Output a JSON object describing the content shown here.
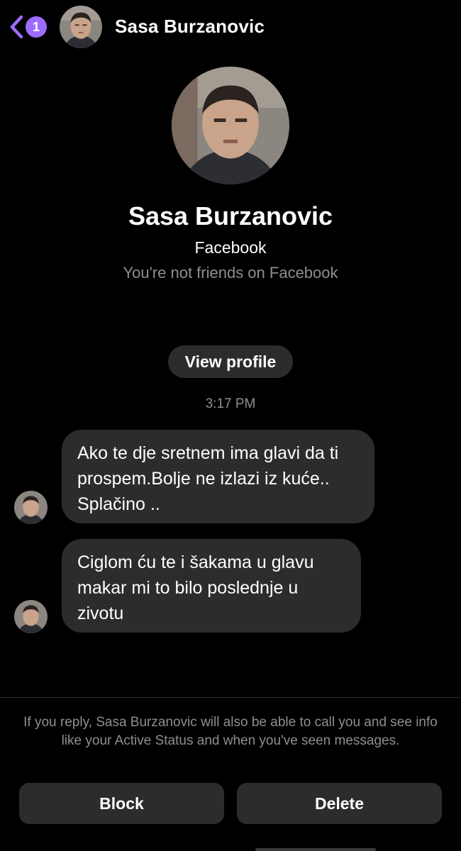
{
  "header": {
    "unread_count": "1",
    "contact_name": "Sasa Burzanovic"
  },
  "profile": {
    "name": "Sasa Burzanovic",
    "source": "Facebook",
    "friend_status": "You're not friends on Facebook",
    "view_profile_label": "View profile"
  },
  "conversation": {
    "timestamp": "3:17 PM",
    "messages": [
      {
        "text": "Ako te dje sretnem ima glavi da ti prospem.Bolje ne izlazi iz kuće.. Splačino .."
      },
      {
        "text": "Ciglom ću te i šakama u glavu makar mi to bilo poslednje u zivotu"
      }
    ]
  },
  "footer": {
    "notice": "If you reply, Sasa Burzanovic will also be able to call you and see info like your Active Status and when you've seen messages.",
    "block_label": "Block",
    "delete_label": "Delete"
  },
  "colors": {
    "accent": "#9d6bff",
    "background": "#000000",
    "bubble": "#2c2c2e",
    "secondary_text": "#8e8e93"
  },
  "icons": {
    "back": "chevron-left-icon"
  }
}
